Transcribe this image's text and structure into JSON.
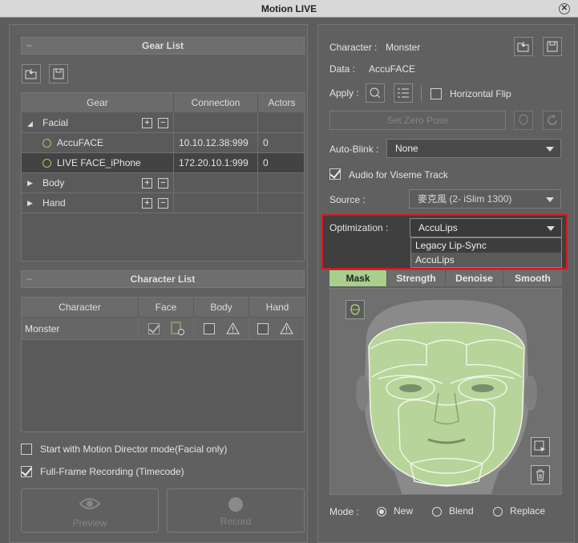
{
  "window": {
    "title": "Motion LIVE"
  },
  "gear_list": {
    "title": "Gear List",
    "columns": [
      "Gear",
      "Connection",
      "Actors"
    ],
    "rows": [
      {
        "name": "Facial",
        "connection": "",
        "actors": ""
      },
      {
        "name": "AccuFACE",
        "connection": "10.10.12.38:999",
        "actors": "0"
      },
      {
        "name": "LIVE FACE_iPhone",
        "connection": "172.20.10.1:999",
        "actors": "0"
      },
      {
        "name": "Body",
        "connection": "",
        "actors": ""
      },
      {
        "name": "Hand",
        "connection": "",
        "actors": ""
      }
    ],
    "plus": "+",
    "minus": "−"
  },
  "character_list": {
    "title": "Character List",
    "columns": [
      "Character",
      "Face",
      "Body",
      "Hand"
    ],
    "rows": [
      {
        "name": "Monster"
      }
    ]
  },
  "options": {
    "motion_director": "Start with Motion Director mode(Facial only)",
    "full_frame": "Full-Frame Recording (Timecode)"
  },
  "buttons": {
    "preview": "Preview",
    "record": "Record",
    "set_zero_pose": "Set Zero Pose"
  },
  "right": {
    "character_label": "Character :",
    "character_value": "Monster",
    "data_label": "Data :",
    "data_value": "AccuFACE",
    "apply_label": "Apply :",
    "horizontal_flip": "Horizontal Flip",
    "auto_blink_label": "Auto-Blink :",
    "auto_blink_value": "None",
    "audio_viseme": "Audio for Viseme Track",
    "source_label": "Source :",
    "source_value": "麥克風 (2- iSlim 1300)",
    "optimization_label": "Optimization :",
    "optimization_value": "AccuLips",
    "optimization_options": [
      "Legacy Lip-Sync",
      "AccuLips"
    ]
  },
  "tabs": [
    "Mask",
    "Strength",
    "Denoise",
    "Smooth"
  ],
  "mode": {
    "label": "Mode :",
    "options": [
      "New",
      "Blend",
      "Replace"
    ],
    "selected": "New"
  },
  "colors": {
    "highlight": "#e0141e",
    "mask_green": "#b7d49a",
    "titlebar": "#d8d8d8"
  }
}
